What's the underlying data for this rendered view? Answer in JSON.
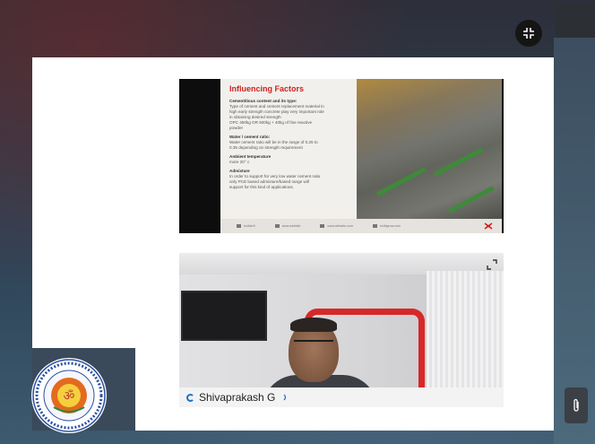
{
  "slide": {
    "title": "Influencing Factors",
    "lines": [
      {
        "text": "Cementitious content and its type:",
        "heading": true
      },
      {
        "text": "Type of cement and cement replacement material  in",
        "heading": false
      },
      {
        "text": "high early strength concrete  play very important role",
        "heading": false
      },
      {
        "text": "in obtaining desired strength",
        "heading": false
      },
      {
        "text": "OPC 450kg OR 500kg + 40kg of fine reactive",
        "heading": false
      },
      {
        "text": "powder",
        "heading": false
      },
      {
        "text": "Water / cement ratio:",
        "heading": true
      },
      {
        "text": "Water cement ratio will be in the range of 0.25 to",
        "heading": false
      },
      {
        "text": "0.35 depending on strength requirement",
        "heading": false
      },
      {
        "text": "Ambient temperature",
        "heading": true
      },
      {
        "text": "more 20° c",
        "heading": false
      },
      {
        "text": "Admixture",
        "heading": true
      },
      {
        "text": "In order to support for very low water cement ratio",
        "heading": false
      },
      {
        "text": "only PCE based admixture/based range will",
        "heading": false
      },
      {
        "text": "support for this kind of applications.",
        "heading": false
      }
    ],
    "footer": [
      "buildcrft",
      "www.website",
      "www.website.com",
      "buildgrow.com"
    ]
  },
  "participant": {
    "name": "Shivaprakash G"
  },
  "icons": {
    "collapse": "collapse-icon",
    "expand": "expand-icon",
    "attach": "paperclip-icon",
    "mic": "mic-active-icon",
    "seal": "college-seal-logo"
  },
  "colors": {
    "slide_title": "#d21f1f",
    "frame_red": "#d72828",
    "speaking_blue": "#1f6fd1"
  }
}
